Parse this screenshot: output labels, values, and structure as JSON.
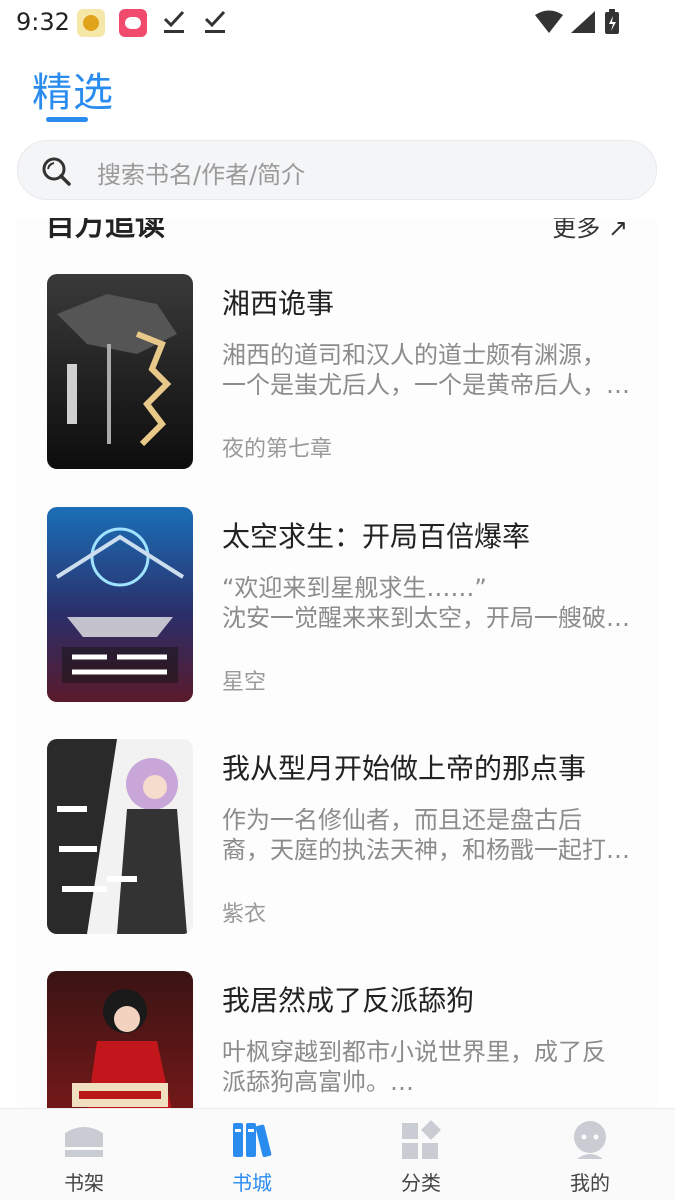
{
  "status_bar": {
    "time": "9:32"
  },
  "header": {
    "tab_title": "精选"
  },
  "search": {
    "placeholder": "搜索书名/作者/简介"
  },
  "section": {
    "title": "百万追读",
    "more_label": "更多 ↗"
  },
  "books": [
    {
      "title": "湘西诡事",
      "desc_line1": "湘西的道司和汉人的道士颇有渊源，",
      "desc_line2": "一个是蚩尤后人，一个是黄帝后人，…",
      "author": "夜的第七章"
    },
    {
      "title": "太空求生：开局百倍爆率",
      "desc_line1": "“欢迎来到星舰求生……”",
      "desc_line2": "沈安一觉醒来来到太空，开局一艘破…",
      "author": "星空"
    },
    {
      "title": "我从型月开始做上帝的那点事",
      "desc_line1": "作为一名修仙者，而且还是盘古后",
      "desc_line2": "裔，天庭的执法天神，和杨戬一起打…",
      "author": "紫衣"
    },
    {
      "title": "我居然成了反派舔狗",
      "desc_line1": "叶枫穿越到都市小说世界里，成了反",
      "desc_line2": "派舔狗高富帅。…",
      "author": ""
    }
  ],
  "bottom_nav": [
    {
      "label": "书架"
    },
    {
      "label": "书城"
    },
    {
      "label": "分类"
    },
    {
      "label": "我的"
    }
  ],
  "colors": {
    "accent": "#2b8cf0",
    "text": "#222222",
    "muted": "#8c8c8c"
  }
}
